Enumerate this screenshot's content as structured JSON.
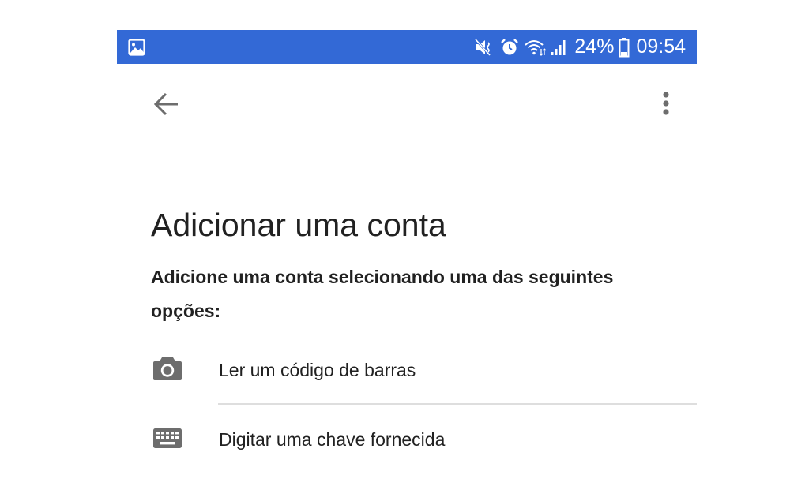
{
  "status_bar": {
    "battery": "24%",
    "time": "09:54",
    "icons": [
      "image-icon",
      "mute-icon",
      "alarm-icon",
      "wifi-icon",
      "signal-icon",
      "battery-icon"
    ],
    "background_color": "#3369d6"
  },
  "toolbar": {
    "back_icon": "arrow-back-icon",
    "more_icon": "more-vert-icon"
  },
  "page": {
    "title": "Adicionar uma conta",
    "subtitle": "Adicione uma conta selecionando uma das seguintes opções:"
  },
  "options": [
    {
      "label": "Ler um código de barras",
      "icon": "camera-icon"
    },
    {
      "label": "Digitar uma chave fornecida",
      "icon": "keyboard-icon"
    }
  ],
  "colors": {
    "text_primary": "#212121",
    "icon_gray": "#6d6d6d",
    "divider": "#dedede"
  }
}
